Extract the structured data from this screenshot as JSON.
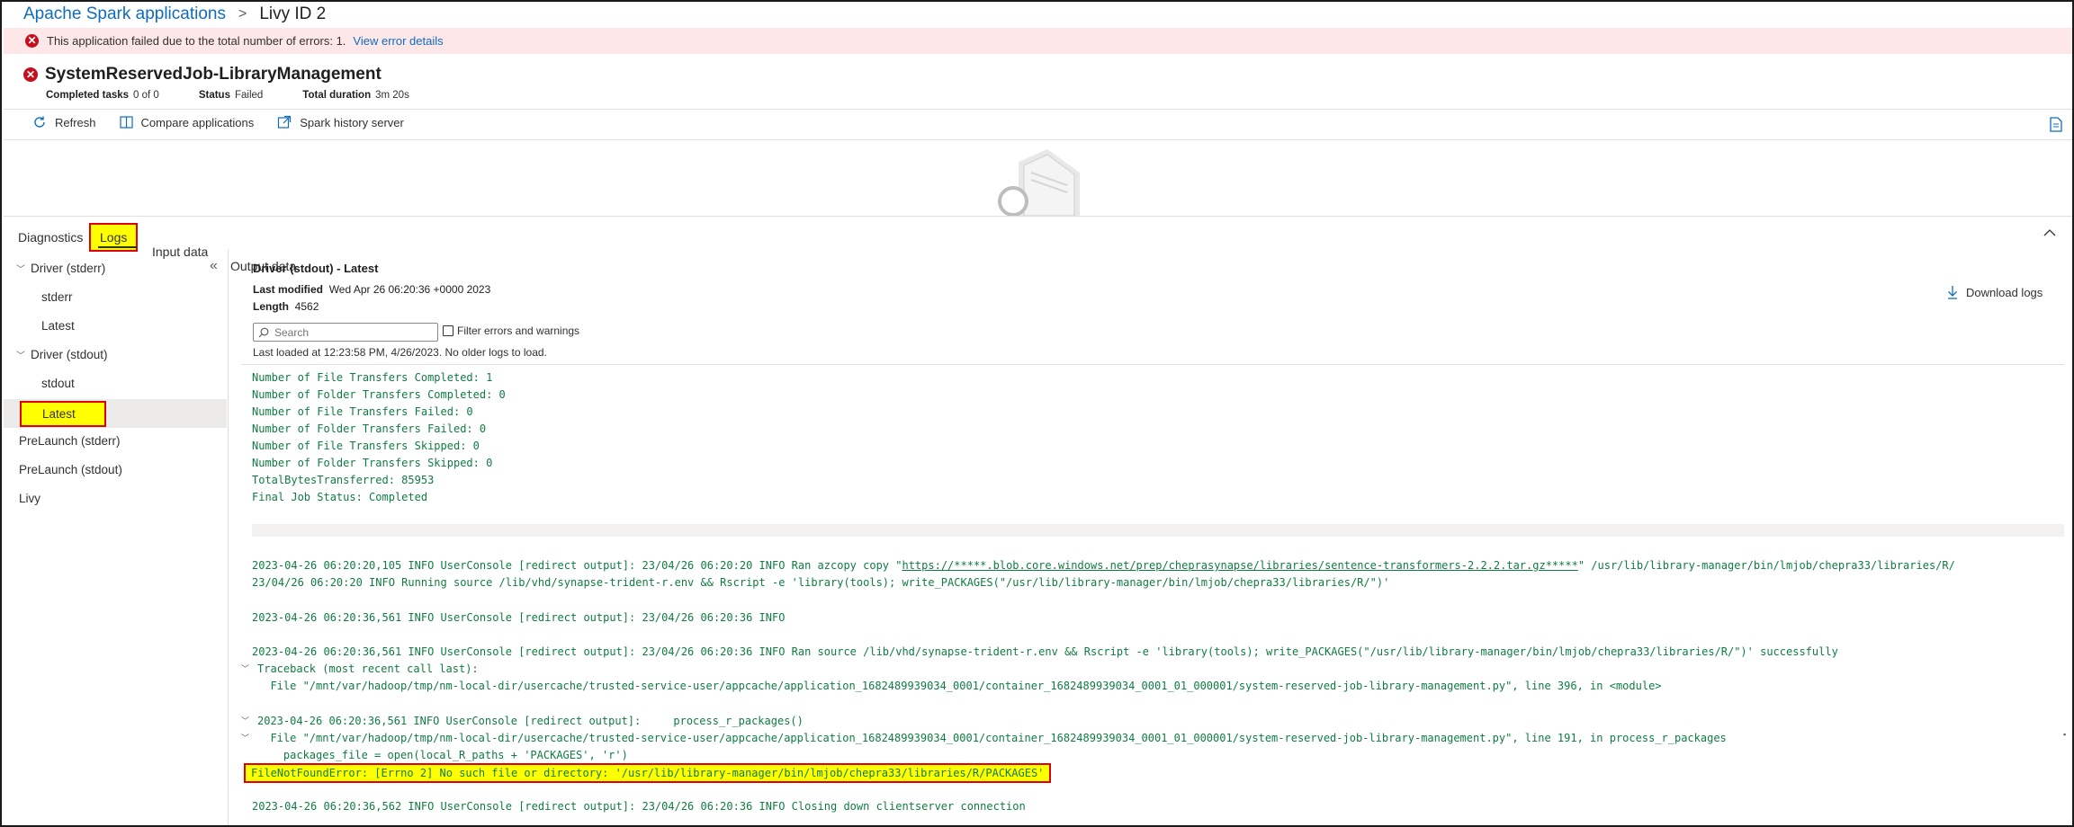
{
  "breadcrumb": {
    "root": "Apache Spark applications",
    "separator": ">",
    "current": "Livy ID 2"
  },
  "error_banner": {
    "message": "This application failed due to the total number of errors: 1.",
    "link": "View error details"
  },
  "app": {
    "name": "SystemReservedJob-LibraryManagement",
    "completed_tasks_label": "Completed tasks",
    "completed_tasks_value": "0 of 0",
    "status_label": "Status",
    "status_value": "Failed",
    "duration_label": "Total duration",
    "duration_value": "3m 20s"
  },
  "toolbar": {
    "refresh": "Refresh",
    "compare": "Compare applications",
    "history": "Spark history server"
  },
  "tabs": [
    {
      "label": "Diagnostics"
    },
    {
      "label": "Logs",
      "selected": true
    },
    {
      "label": "Input data"
    },
    {
      "label": "Output data"
    }
  ],
  "sidebar": {
    "items": [
      {
        "label": "Driver (stderr)",
        "group": true
      },
      {
        "label": "stderr"
      },
      {
        "label": "Latest"
      },
      {
        "label": "Driver (stdout)",
        "group": true
      },
      {
        "label": "stdout"
      },
      {
        "label": "Latest",
        "selected": true
      },
      {
        "label": "PreLaunch (stderr)"
      },
      {
        "label": "PreLaunch (stdout)"
      },
      {
        "label": "Livy"
      }
    ]
  },
  "log_panel": {
    "title": "Driver (stdout) - Latest",
    "last_modified_label": "Last modified",
    "last_modified_value": "Wed Apr 26 06:20:36 +0000 2023",
    "length_label": "Length",
    "length_value": "4562",
    "search_placeholder": "Search",
    "filter_label": "Filter errors and warnings",
    "last_loaded": "Last loaded at 12:23:58 PM, 4/26/2023. No older logs to load.",
    "download": "Download logs"
  },
  "log_lines": {
    "l1": "Number of File Transfers Completed: 1",
    "l2": "Number of Folder Transfers Completed: 0",
    "l3": "Number of File Transfers Failed: 0",
    "l4": "Number of Folder Transfers Failed: 0",
    "l5": "Number of File Transfers Skipped: 0",
    "l6": "Number of Folder Transfers Skipped: 0",
    "l7": "TotalBytesTransferred: 85953",
    "l8": "Final Job Status: Completed",
    "l9a": "2023-04-26 06:20:20,105 INFO UserConsole [redirect output]: 23/04/26 06:20:20 INFO Ran azcopy copy \"",
    "l9link": "https://*****.blob.core.windows.net/prep/cheprasynapse/libraries/sentence-transformers-2.2.2.tar.gz*****",
    "l9b": "\" /usr/lib/library-manager/bin/lmjob/chepra33/libraries/R/",
    "l10": "23/04/26 06:20:20 INFO Running source /lib/vhd/synapse-trident-r.env && Rscript -e 'library(tools); write_PACKAGES(\"/usr/lib/library-manager/bin/lmjob/chepra33/libraries/R/\")'",
    "l11": "2023-04-26 06:20:36,561 INFO UserConsole [redirect output]: 23/04/26 06:20:36 INFO",
    "l12": "2023-04-26 06:20:36,561 INFO UserConsole [redirect output]: 23/04/26 06:20:36 INFO Ran source /lib/vhd/synapse-trident-r.env && Rscript -e 'library(tools); write_PACKAGES(\"/usr/lib/library-manager/bin/lmjob/chepra33/libraries/R/\")' successfully",
    "l13": "Traceback (most recent call last):",
    "l14": "  File \"/mnt/var/hadoop/tmp/nm-local-dir/usercache/trusted-service-user/appcache/application_1682489939034_0001/container_1682489939034_0001_01_000001/system-reserved-job-library-management.py\", line 396, in <module>",
    "l15": "2023-04-26 06:20:36,561 INFO UserConsole [redirect output]:     process_r_packages()",
    "l16": "  File \"/mnt/var/hadoop/tmp/nm-local-dir/usercache/trusted-service-user/appcache/application_1682489939034_0001/container_1682489939034_0001_01_000001/system-reserved-job-library-management.py\", line 191, in process_r_packages",
    "l17": "    packages_file = open(local_R_paths + 'PACKAGES', 'r')",
    "l18": "FileNotFoundError: [Errno 2] No such file or directory: '/usr/lib/library-manager/bin/lmjob/chepra33/libraries/R/PACKAGES'",
    "l19": "2023-04-26 06:20:36,562 INFO UserConsole [redirect output]: 23/04/26 06:20:36 INFO Closing down clientserver connection"
  },
  "colors": {
    "error": "#c50f1f",
    "link": "#0f6cbd",
    "log_text": "#107c41",
    "highlight": "#ffff00",
    "highlight_border": "#e00000"
  }
}
